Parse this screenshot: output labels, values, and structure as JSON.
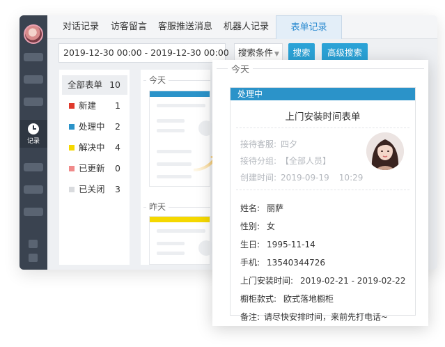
{
  "tabs": [
    {
      "label": "对话记录"
    },
    {
      "label": "访客留言"
    },
    {
      "label": "客服推送消息"
    },
    {
      "label": "机器人记录"
    },
    {
      "label": "表单记录",
      "active": true
    }
  ],
  "sidebar": {
    "record_label": "记录"
  },
  "toolbar": {
    "date_range": "2019-12-30 00:00 - 2019-12-30 00:00",
    "search_condition": "搜索条件",
    "search_button": "搜索",
    "advanced_search_button": "高级搜索"
  },
  "filters": [
    {
      "label": "全部表单",
      "count": "10",
      "color": null,
      "active": true
    },
    {
      "label": "新建",
      "count": "1",
      "color": "#e03a2c"
    },
    {
      "label": "处理中",
      "count": "2",
      "color": "#2b93c9"
    },
    {
      "label": "解决中",
      "count": "4",
      "color": "#f5d800"
    },
    {
      "label": "已更新",
      "count": "0",
      "color": "#f08a8a"
    },
    {
      "label": "已关闭",
      "count": "3",
      "color": "#d9dbde"
    }
  ],
  "list": {
    "today_label": "今天",
    "yesterday_label": "昨天",
    "today_card_color": "#2b93c9",
    "yesterday_card_color": "#f5d800"
  },
  "popup": {
    "day_label": "今天",
    "status": "处理中",
    "title": "上门安装时间表单",
    "meta": {
      "agent_label": "接待客服:",
      "agent_value": "四夕",
      "group_label": "接待分组:",
      "group_value": "【全部人员】",
      "created_label": "创建时间:",
      "created_date": "2019-09-19",
      "created_time": "10:29"
    },
    "fields": [
      {
        "label": "姓名:",
        "value": "丽萨"
      },
      {
        "label": "性别:",
        "value": "女"
      },
      {
        "label": "生日:",
        "value": "1995-11-14"
      },
      {
        "label": "手机:",
        "value": "13540344726"
      },
      {
        "label": "上门安装时间:",
        "value": "2019-02-21 - 2019-02-22"
      },
      {
        "label": "橱柜款式:",
        "value": "欧式落地橱柜"
      },
      {
        "label": "备注:",
        "value": "请尽快安排时间，来前先打电话~"
      }
    ]
  },
  "colors": {
    "accent": "#2ba2d6",
    "sidebar_bg": "#3a4350",
    "status_processing": "#2b93c9"
  }
}
